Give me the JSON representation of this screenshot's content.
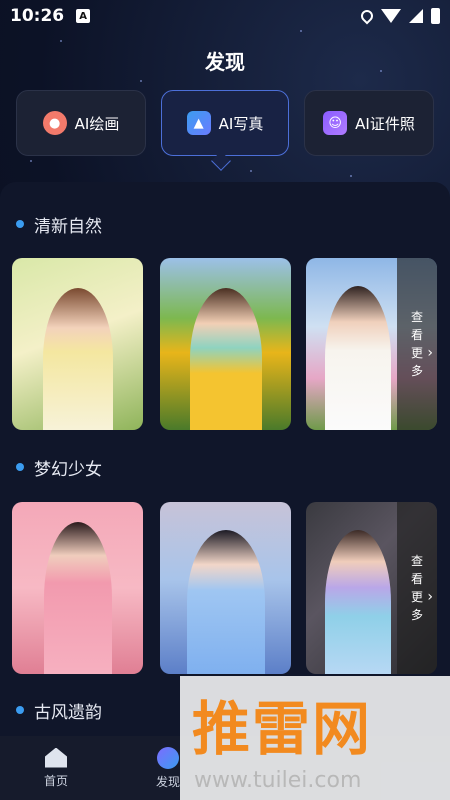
{
  "status": {
    "time": "10:26",
    "badge": "A"
  },
  "page": {
    "title": "发现"
  },
  "categories": [
    {
      "label": "AI绘画",
      "icon": "palette-icon"
    },
    {
      "label": "AI写真",
      "icon": "photo-icon"
    },
    {
      "label": "AI证件照",
      "icon": "id-photo-icon"
    }
  ],
  "sections": [
    {
      "title": "清新自然",
      "more": [
        "查",
        "看",
        "更",
        "多"
      ]
    },
    {
      "title": "梦幻少女",
      "more": [
        "查",
        "看",
        "更",
        "多"
      ]
    },
    {
      "title": "古风遗韵"
    }
  ],
  "nav": [
    {
      "label": "首页",
      "icon": "home-icon"
    },
    {
      "label": "发现",
      "icon": "discover-icon"
    }
  ],
  "watermark": {
    "big": "推雷网",
    "small": "www.tuilei.com"
  },
  "colors": {
    "accent": "#3b9cf0",
    "watermark": "#f28a1f"
  }
}
